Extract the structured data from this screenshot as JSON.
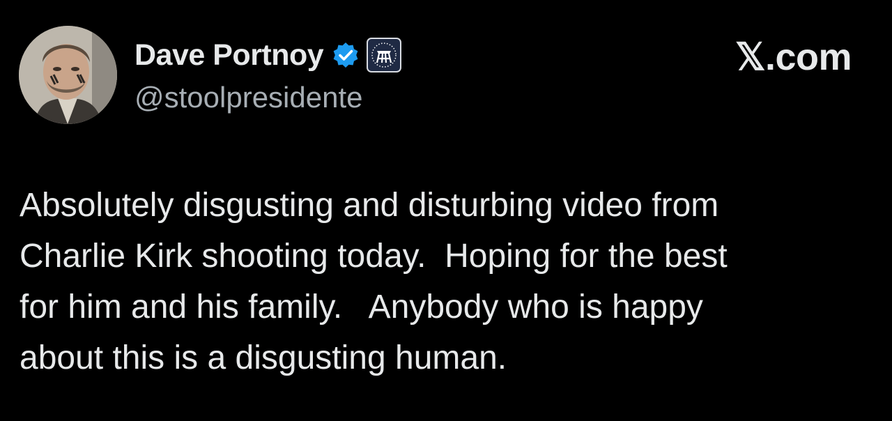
{
  "tweet": {
    "author": {
      "display_name": "Dave Portnoy",
      "handle": "@stoolpresidente",
      "avatar_icon": "profile-photo",
      "verified_icon": "verified-badge-icon",
      "affiliate_icon": "barstool-logo-icon"
    },
    "site_label": "𝕏.com",
    "text_lines": [
      "Absolutely disgusting and disturbing video from",
      "Charlie Kirk shooting today.  Hoping for the best",
      "for him and his family.   Anybody who is happy",
      "about this is a disgusting human."
    ]
  },
  "colors": {
    "background": "#000000",
    "primary_text": "#e7e9ea",
    "secondary_text": "#a7aeb4",
    "verified_blue": "#1d9bf0",
    "affiliate_navy": "#1f2a44"
  }
}
